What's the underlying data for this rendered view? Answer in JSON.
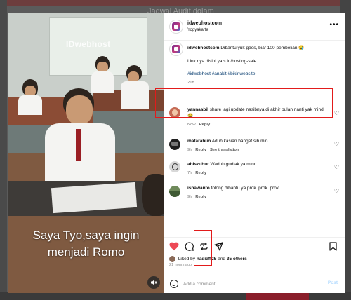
{
  "background": {
    "top_text": "Jadwal Audit dolam"
  },
  "post": {
    "author": "idwebhostcom",
    "location": "Yogyakarta",
    "more_icon": "more-horizontal-icon",
    "video": {
      "watermark": "IDwebhost",
      "caption_line1": "Saya Tyo,saya ingin",
      "caption_line2": "menjadi Romo",
      "mute_icon": "speaker-muted-icon"
    },
    "caption": {
      "username": "idwebhostcom",
      "text": "Dibantu yuk gaes, biar 100 pembelian 😭",
      "link_line": "Link nya disini ya s.id/hosting-sale",
      "hashtags": "#idwebhost #anakit #bikinwebsite",
      "time": "21h"
    }
  },
  "comments": [
    {
      "username": "yannaabil",
      "text": "share lagi update nasibnya di akhir bulan nanti yak mind 😂",
      "time": "Now",
      "reply": "Reply",
      "extra": "",
      "avatar_color": "#c46a54"
    },
    {
      "username": "matarabun",
      "text": "Aduh kasian banget sih min",
      "time": "9h",
      "reply": "Reply",
      "extra": "See translation",
      "avatar_color": "#1f1f1f"
    },
    {
      "username": "abiszuhur",
      "text": "Waduh gudlak ya mind",
      "time": "7h",
      "reply": "Reply",
      "extra": "",
      "avatar_color": "#d8d8d8"
    },
    {
      "username": "isnawanto",
      "text": "tolong dibantu ya prok..prok..prok",
      "time": "9h",
      "reply": "Reply",
      "extra": "",
      "avatar_color": "#6f8a5b"
    }
  ],
  "actions": {
    "like_icon": "heart-filled-icon",
    "comment_icon": "comment-icon",
    "repost_icon": "repost-icon",
    "share_icon": "send-icon",
    "save_icon": "bookmark-icon",
    "liked_prefix": "Liked by",
    "liked_user": "nadiaff25",
    "liked_and": "and",
    "liked_others": "35 others",
    "time_ago": "21 hours ago",
    "like_color": "#ed4956"
  },
  "add_comment": {
    "placeholder": "Add a comment...",
    "post_label": "Post",
    "emoji_icon": "emoji-icon"
  },
  "annotation_color": "#e21b1b"
}
